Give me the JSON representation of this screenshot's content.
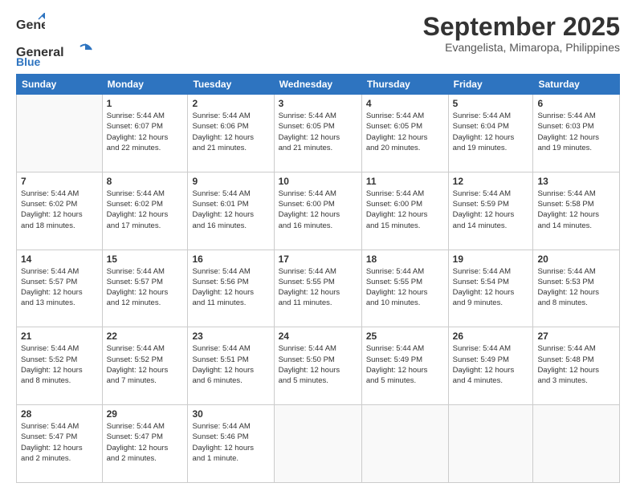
{
  "header": {
    "logo_general": "General",
    "logo_blue": "Blue",
    "month": "September 2025",
    "location": "Evangelista, Mimaropa, Philippines"
  },
  "weekdays": [
    "Sunday",
    "Monday",
    "Tuesday",
    "Wednesday",
    "Thursday",
    "Friday",
    "Saturday"
  ],
  "weeks": [
    [
      {
        "day": "",
        "info": ""
      },
      {
        "day": "1",
        "info": "Sunrise: 5:44 AM\nSunset: 6:07 PM\nDaylight: 12 hours\nand 22 minutes."
      },
      {
        "day": "2",
        "info": "Sunrise: 5:44 AM\nSunset: 6:06 PM\nDaylight: 12 hours\nand 21 minutes."
      },
      {
        "day": "3",
        "info": "Sunrise: 5:44 AM\nSunset: 6:05 PM\nDaylight: 12 hours\nand 21 minutes."
      },
      {
        "day": "4",
        "info": "Sunrise: 5:44 AM\nSunset: 6:05 PM\nDaylight: 12 hours\nand 20 minutes."
      },
      {
        "day": "5",
        "info": "Sunrise: 5:44 AM\nSunset: 6:04 PM\nDaylight: 12 hours\nand 19 minutes."
      },
      {
        "day": "6",
        "info": "Sunrise: 5:44 AM\nSunset: 6:03 PM\nDaylight: 12 hours\nand 19 minutes."
      }
    ],
    [
      {
        "day": "7",
        "info": "Sunrise: 5:44 AM\nSunset: 6:02 PM\nDaylight: 12 hours\nand 18 minutes."
      },
      {
        "day": "8",
        "info": "Sunrise: 5:44 AM\nSunset: 6:02 PM\nDaylight: 12 hours\nand 17 minutes."
      },
      {
        "day": "9",
        "info": "Sunrise: 5:44 AM\nSunset: 6:01 PM\nDaylight: 12 hours\nand 16 minutes."
      },
      {
        "day": "10",
        "info": "Sunrise: 5:44 AM\nSunset: 6:00 PM\nDaylight: 12 hours\nand 16 minutes."
      },
      {
        "day": "11",
        "info": "Sunrise: 5:44 AM\nSunset: 6:00 PM\nDaylight: 12 hours\nand 15 minutes."
      },
      {
        "day": "12",
        "info": "Sunrise: 5:44 AM\nSunset: 5:59 PM\nDaylight: 12 hours\nand 14 minutes."
      },
      {
        "day": "13",
        "info": "Sunrise: 5:44 AM\nSunset: 5:58 PM\nDaylight: 12 hours\nand 14 minutes."
      }
    ],
    [
      {
        "day": "14",
        "info": "Sunrise: 5:44 AM\nSunset: 5:57 PM\nDaylight: 12 hours\nand 13 minutes."
      },
      {
        "day": "15",
        "info": "Sunrise: 5:44 AM\nSunset: 5:57 PM\nDaylight: 12 hours\nand 12 minutes."
      },
      {
        "day": "16",
        "info": "Sunrise: 5:44 AM\nSunset: 5:56 PM\nDaylight: 12 hours\nand 11 minutes."
      },
      {
        "day": "17",
        "info": "Sunrise: 5:44 AM\nSunset: 5:55 PM\nDaylight: 12 hours\nand 11 minutes."
      },
      {
        "day": "18",
        "info": "Sunrise: 5:44 AM\nSunset: 5:55 PM\nDaylight: 12 hours\nand 10 minutes."
      },
      {
        "day": "19",
        "info": "Sunrise: 5:44 AM\nSunset: 5:54 PM\nDaylight: 12 hours\nand 9 minutes."
      },
      {
        "day": "20",
        "info": "Sunrise: 5:44 AM\nSunset: 5:53 PM\nDaylight: 12 hours\nand 8 minutes."
      }
    ],
    [
      {
        "day": "21",
        "info": "Sunrise: 5:44 AM\nSunset: 5:52 PM\nDaylight: 12 hours\nand 8 minutes."
      },
      {
        "day": "22",
        "info": "Sunrise: 5:44 AM\nSunset: 5:52 PM\nDaylight: 12 hours\nand 7 minutes."
      },
      {
        "day": "23",
        "info": "Sunrise: 5:44 AM\nSunset: 5:51 PM\nDaylight: 12 hours\nand 6 minutes."
      },
      {
        "day": "24",
        "info": "Sunrise: 5:44 AM\nSunset: 5:50 PM\nDaylight: 12 hours\nand 5 minutes."
      },
      {
        "day": "25",
        "info": "Sunrise: 5:44 AM\nSunset: 5:49 PM\nDaylight: 12 hours\nand 5 minutes."
      },
      {
        "day": "26",
        "info": "Sunrise: 5:44 AM\nSunset: 5:49 PM\nDaylight: 12 hours\nand 4 minutes."
      },
      {
        "day": "27",
        "info": "Sunrise: 5:44 AM\nSunset: 5:48 PM\nDaylight: 12 hours\nand 3 minutes."
      }
    ],
    [
      {
        "day": "28",
        "info": "Sunrise: 5:44 AM\nSunset: 5:47 PM\nDaylight: 12 hours\nand 2 minutes."
      },
      {
        "day": "29",
        "info": "Sunrise: 5:44 AM\nSunset: 5:47 PM\nDaylight: 12 hours\nand 2 minutes."
      },
      {
        "day": "30",
        "info": "Sunrise: 5:44 AM\nSunset: 5:46 PM\nDaylight: 12 hours\nand 1 minute."
      },
      {
        "day": "",
        "info": ""
      },
      {
        "day": "",
        "info": ""
      },
      {
        "day": "",
        "info": ""
      },
      {
        "day": "",
        "info": ""
      }
    ]
  ]
}
